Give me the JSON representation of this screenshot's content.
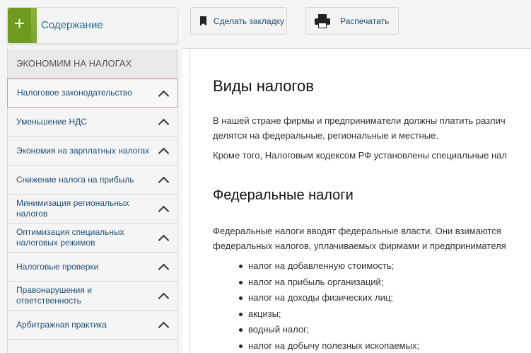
{
  "toc": {
    "plus_symbol": "+",
    "title": "Содержание"
  },
  "sidebar": {
    "section_title": "ЭКОНОМИМ НА НАЛОГАХ",
    "items": [
      {
        "label": "Налоговое законодательство"
      },
      {
        "label": "Уменьшение НДС"
      },
      {
        "label": "Экономия на зарплатных налогах"
      },
      {
        "label": "Снижение налога на прибыль"
      },
      {
        "label": "Минимизация региональных налогов"
      },
      {
        "label": "Оптимизация специальных налоговых режимов"
      },
      {
        "label": "Налоговые проверки"
      },
      {
        "label": "Правонарушения и ответственность"
      },
      {
        "label": "Арбитражная практика"
      }
    ]
  },
  "toolbar": {
    "bookmark_label": "Сделать закладку",
    "print_label": "Распечатать"
  },
  "article": {
    "title": "Виды налогов",
    "p1_line1": "В нашей стране фирмы и предприниматели должны платить различ",
    "p1_line2": "делятся на федеральные, региональные и местные.",
    "p2": "Кроме того, Налоговым кодексом РФ установлены специальные нал",
    "subtitle": "Федеральные налоги",
    "p3_line1": "Федеральные налоги вводят федеральные власти. Они взимаются",
    "p3_line2": "федеральных налогов, уплачиваемых фирмами и предпринимателя",
    "taxes": [
      "налог на добавленную стоимость;",
      "налог на прибыль организаций;",
      "налог на доходы физических лиц;",
      "акцизы;",
      "водный налог;",
      "налог на добычу полезных ископаемых;"
    ]
  }
}
